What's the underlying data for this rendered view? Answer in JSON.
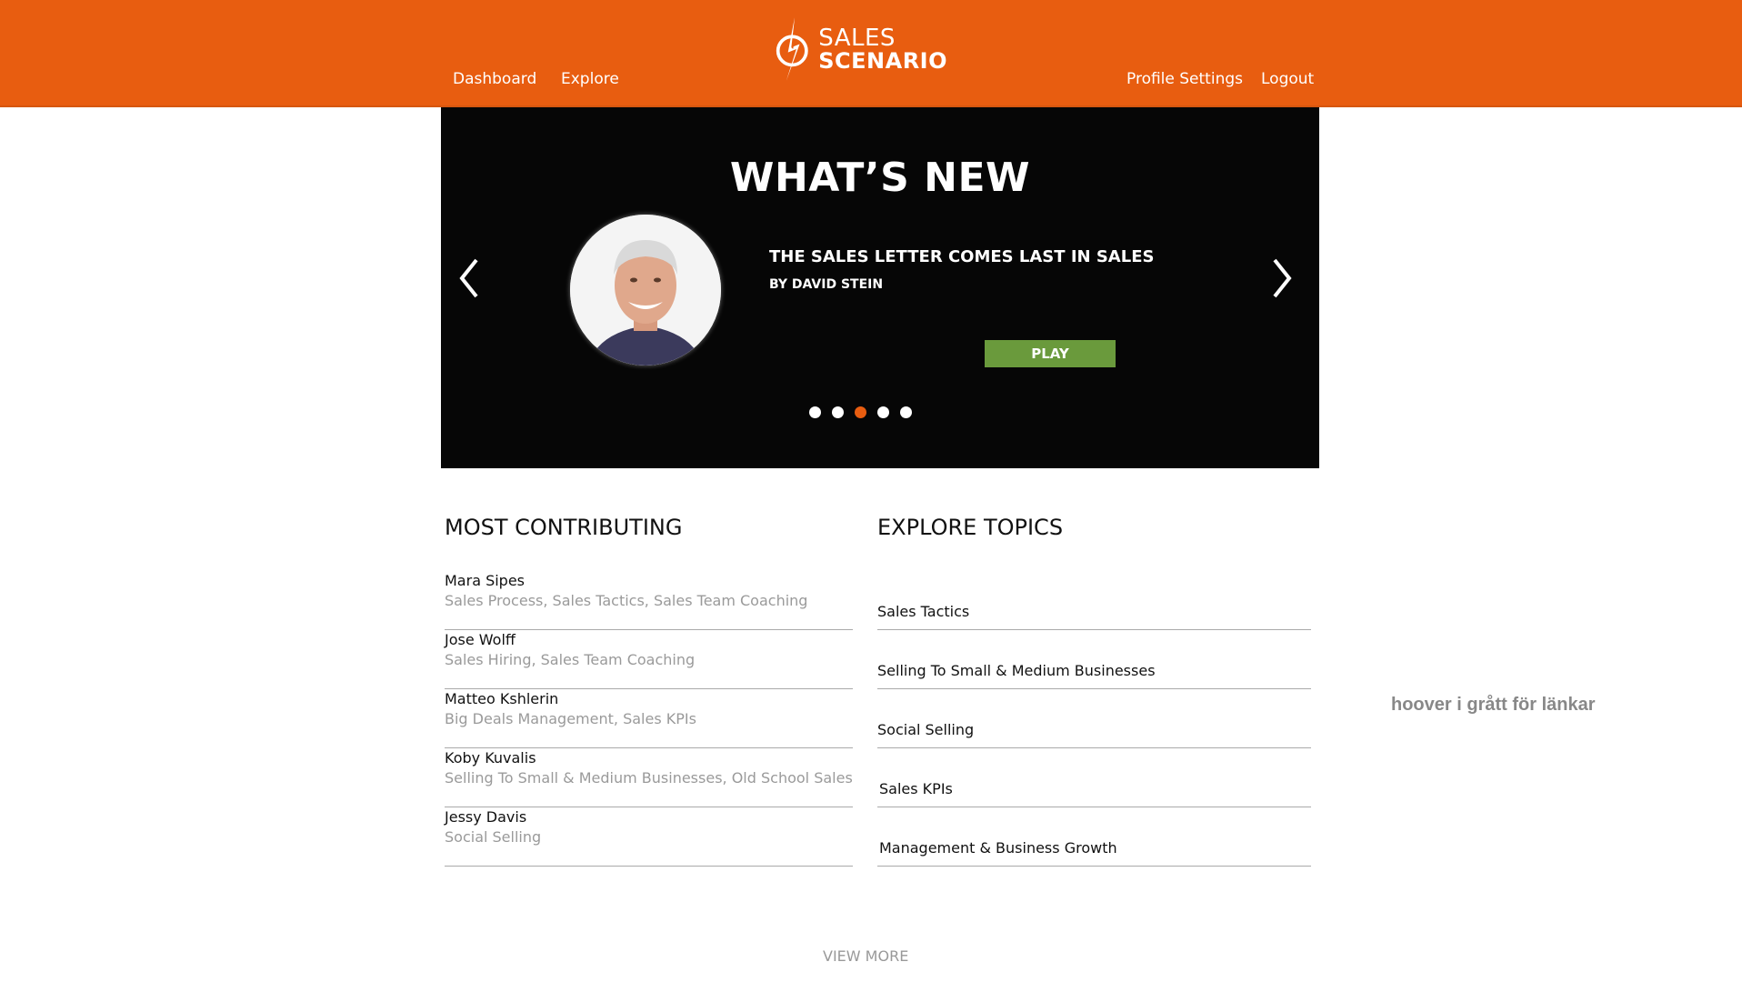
{
  "header": {
    "logo_line1": "SALES",
    "logo_line2": "SCENARIO",
    "nav_left": [
      "Dashboard",
      "Explore"
    ],
    "nav_right": [
      "Profile Settings",
      "Logout"
    ],
    "background_color": "#e85d10"
  },
  "hero": {
    "title": "WHAT’S NEW",
    "feature_title": "THE SALES  LETTER COMES LAST IN SALES",
    "feature_author": "BY DAVID STEIN",
    "play_label": "PLAY",
    "slide_count": 5,
    "active_slide": 3,
    "play_color": "#6a9a3c"
  },
  "most_contributing": {
    "title": "MOST CONTRIBUTING",
    "items": [
      {
        "name": "Mara Sipes",
        "tags": "Sales Process, Sales Tactics, Sales Team Coaching"
      },
      {
        "name": "Jose Wolff",
        "tags": "Sales Hiring, Sales Team Coaching"
      },
      {
        "name": "Matteo Kshlerin",
        "tags": "Big Deals Management, Sales KPIs"
      },
      {
        "name": "Koby Kuvalis",
        "tags": "Selling To Small & Medium Businesses, Old School Sales"
      },
      {
        "name": "Jessy Davis",
        "tags": "Social Selling"
      }
    ]
  },
  "explore_topics": {
    "title": "EXPLORE TOPICS",
    "items": [
      "Sales Tactics",
      "Selling To Small & Medium Businesses",
      "Social Selling",
      "Sales KPIs",
      "Management & Business Growth"
    ]
  },
  "annotation": "hoover i grått för länkar",
  "view_more": "VIEW MORE"
}
